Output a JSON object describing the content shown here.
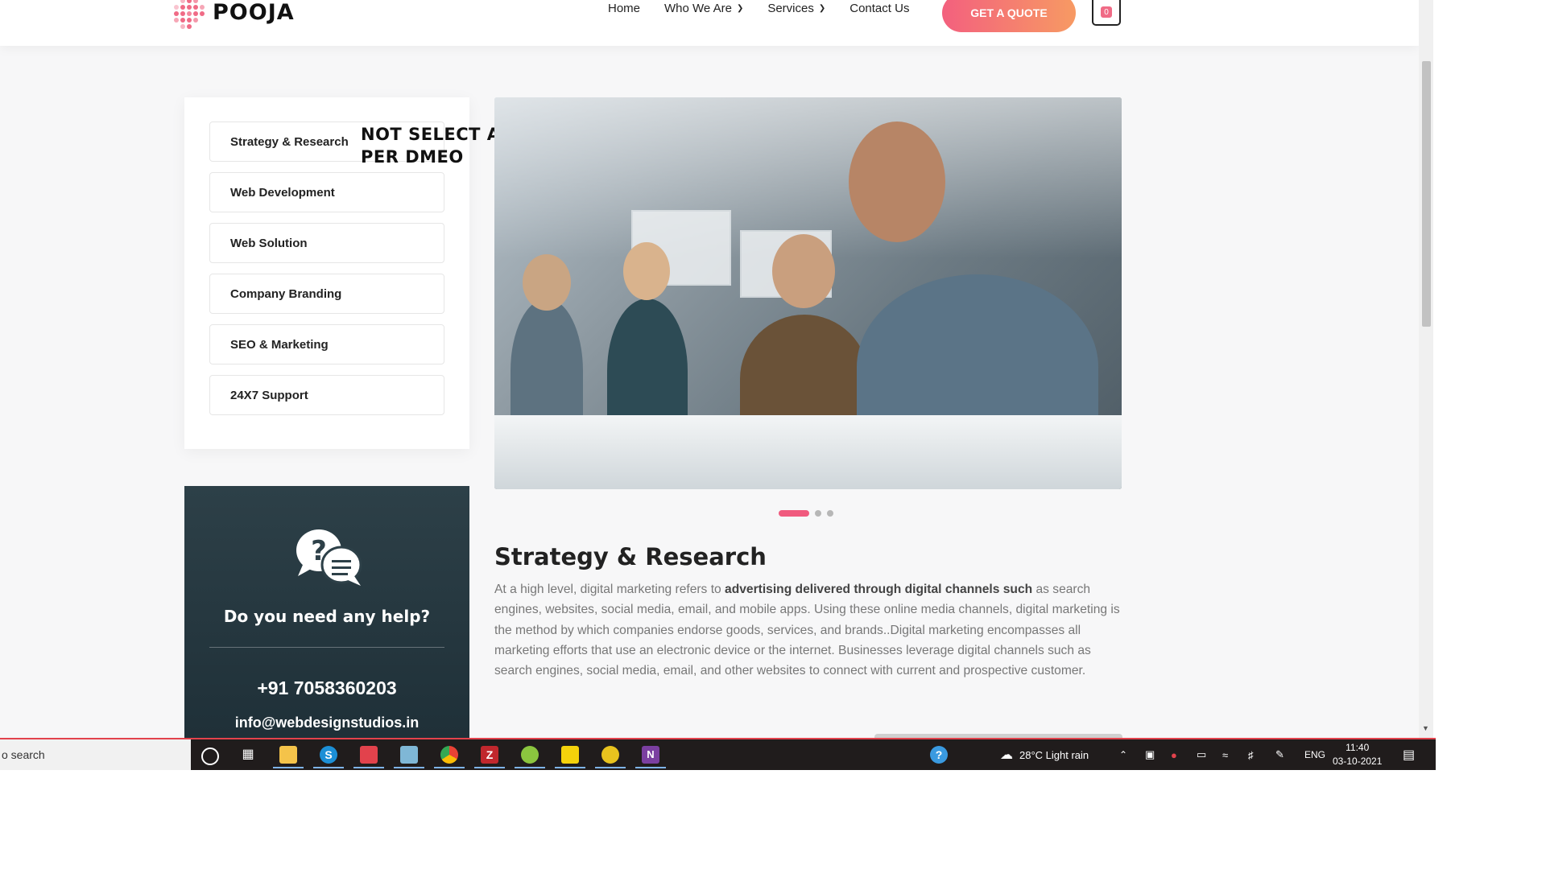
{
  "header": {
    "logo_text": "POOJA",
    "nav": [
      "Home",
      "Who We Are",
      "Services",
      "Contact Us"
    ],
    "quote_button": "GET A QUOTE",
    "cart_count": "0"
  },
  "sidebar": {
    "items": [
      "Strategy & Research",
      "Web Development",
      "Web Solution",
      "Company Branding",
      "SEO & Marketing",
      "24X7 Support"
    ],
    "annotation_line1": "NOT SELECT AS",
    "annotation_line2": "PER DMEO"
  },
  "help": {
    "title": "Do you need any help?",
    "phone": "+91 7058360203",
    "email": "info@webdesignstudios.in"
  },
  "content": {
    "title": "Strategy & Research",
    "body_1": "At a high level, digital marketing refers to ",
    "body_bold": "advertising delivered through digital channels such",
    "body_2": " as search engines, websites, social media, email, and mobile apps. Using these online media channels, digital marketing is the method by which companies endorse goods, services, and brands..Digital marketing encompasses all marketing efforts that use an electronic device or the internet. Businesses leverage digital channels such as search engines, social media, email, and other websites to connect with current and prospective customer."
  },
  "carousel": {
    "slides": 3,
    "active": 1
  },
  "taskbar": {
    "search_text": "o search",
    "weather": "28°C  Light rain",
    "language": "ENG",
    "time": "11:40",
    "date": "03-10-2021"
  },
  "colors": {
    "accent": "#f05a7e",
    "gradient_end": "#f79a63",
    "help_bg": "#2d4048"
  }
}
